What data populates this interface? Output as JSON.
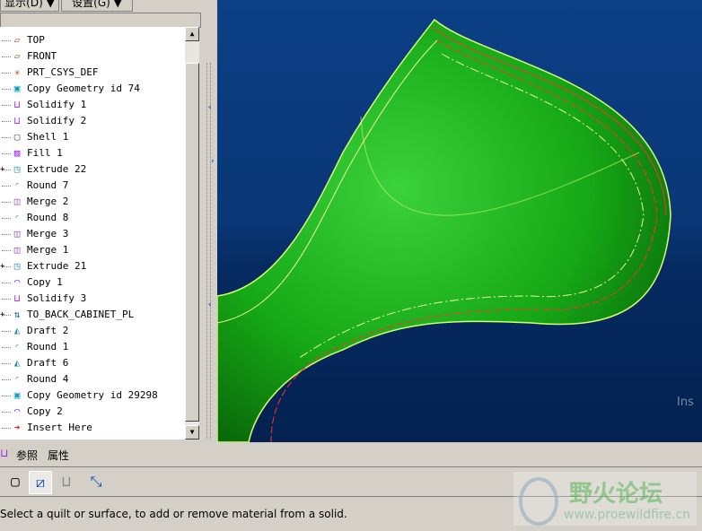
{
  "menus": {
    "display": "显示(D) ▼",
    "settings": "设置(G) ▼"
  },
  "tree": [
    {
      "label": "TOP",
      "icon": "datum-plane-icon",
      "glyph": "▱",
      "color": "#a0522d"
    },
    {
      "label": "FRONT",
      "icon": "datum-plane-icon",
      "glyph": "▱",
      "color": "#a0522d"
    },
    {
      "label": "PRT_CSYS_DEF",
      "icon": "csys-icon",
      "glyph": "✳",
      "color": "#a0522d"
    },
    {
      "label": "Copy Geometry id 74",
      "icon": "copy-geometry-icon",
      "glyph": "▣",
      "color": "#10a0c0"
    },
    {
      "label": "Solidify 1",
      "icon": "solidify-icon",
      "glyph": "⊔",
      "color": "#a020f0"
    },
    {
      "label": "Solidify 2",
      "icon": "solidify-icon",
      "glyph": "⊔",
      "color": "#a020f0"
    },
    {
      "label": "Shell 1",
      "icon": "shell-icon",
      "glyph": "▢",
      "color": "#406080"
    },
    {
      "label": "Fill 1",
      "icon": "fill-icon",
      "glyph": "▨",
      "color": "#a020f0"
    },
    {
      "label": "Extrude 22",
      "icon": "extrude-icon",
      "glyph": "◳",
      "color": "#2090b0",
      "expand": true
    },
    {
      "label": "Round 7",
      "icon": "round-icon",
      "glyph": "◜",
      "color": "#40a0c0"
    },
    {
      "label": "Merge 2",
      "icon": "merge-icon",
      "glyph": "◫",
      "color": "#8040c0"
    },
    {
      "label": "Round 8",
      "icon": "round-icon",
      "glyph": "◜",
      "color": "#40a0c0"
    },
    {
      "label": "Merge 3",
      "icon": "merge-icon",
      "glyph": "◫",
      "color": "#8040c0"
    },
    {
      "label": "Merge 1",
      "icon": "merge-icon",
      "glyph": "◫",
      "color": "#8040c0"
    },
    {
      "label": "Extrude 21",
      "icon": "extrude-icon",
      "glyph": "◳",
      "color": "#2090b0",
      "expand": true
    },
    {
      "label": "Copy 1",
      "icon": "copy-icon",
      "glyph": "◠",
      "color": "#a020f0"
    },
    {
      "label": "Solidify 3",
      "icon": "solidify-icon",
      "glyph": "⊔",
      "color": "#a020f0"
    },
    {
      "label": "TO_BACK_CABINET_PL",
      "icon": "group-icon",
      "glyph": "⇅",
      "color": "#2060a0",
      "expand": true
    },
    {
      "label": "Draft 2",
      "icon": "draft-icon",
      "glyph": "◭",
      "color": "#2090b0"
    },
    {
      "label": "Round 1",
      "icon": "round-icon",
      "glyph": "◜",
      "color": "#40a0c0"
    },
    {
      "label": "Draft 6",
      "icon": "draft-icon",
      "glyph": "◭",
      "color": "#2090b0"
    },
    {
      "label": "Round 4",
      "icon": "round-icon",
      "glyph": "◜",
      "color": "#40a0c0"
    },
    {
      "label": "Copy Geometry id 29298",
      "icon": "copy-geometry-icon",
      "glyph": "▣",
      "color": "#10a0c0"
    },
    {
      "label": "Copy 2",
      "icon": "copy-icon",
      "glyph": "◠",
      "color": "#a020f0"
    },
    {
      "label": "Insert Here",
      "icon": "insert-arrow-icon",
      "glyph": "➔",
      "color": "#e00000"
    }
  ],
  "tabs": {
    "references": "参照",
    "properties": "属性"
  },
  "status": "Select a quilt or surface, to add or remove material from a solid.",
  "viewport_hint": "Ins",
  "watermark": {
    "title": "野火论坛",
    "url": "www.proewildfire.cn"
  }
}
